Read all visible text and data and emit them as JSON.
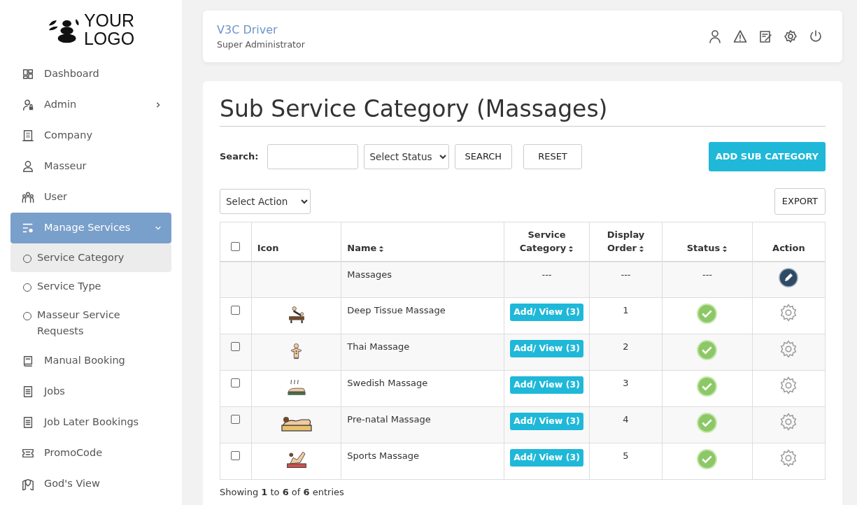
{
  "logo": {
    "line_1": "YOUR",
    "line_2": "LOGO"
  },
  "sidebar": {
    "items": [
      {
        "label": "Dashboard",
        "selected": false
      },
      {
        "label": "Admin",
        "selected": false,
        "expanded": false
      },
      {
        "label": "Company",
        "selected": false
      },
      {
        "label": "Masseur",
        "selected": false
      },
      {
        "label": "User",
        "selected": false
      },
      {
        "label": "Manage Services",
        "selected": true,
        "expanded": true,
        "children": [
          {
            "label": "Service Category",
            "selected": true
          },
          {
            "label": "Service Type",
            "selected": false
          },
          {
            "label": "Masseur Service Requests",
            "selected": false
          }
        ]
      },
      {
        "label": "Manual Booking",
        "selected": false
      },
      {
        "label": "Jobs",
        "selected": false
      },
      {
        "label": "Job Later Bookings",
        "selected": false
      },
      {
        "label": "PromoCode",
        "selected": false
      },
      {
        "label": "God's View",
        "selected": false
      }
    ]
  },
  "header": {
    "user_name": "V3C Driver",
    "role": "Super Administrator"
  },
  "page": {
    "title": "Sub Service Category (Massages)",
    "search_label": "Search:",
    "status_select": "Select Status",
    "search_button": "SEARCH",
    "reset_button": "RESET",
    "add_button": "ADD SUB CATEGORY",
    "action_select": "Select Action",
    "export_button": "EXPORT"
  },
  "table": {
    "select_all_checked": false,
    "columns": [
      {
        "label": "Icon",
        "sortable": false
      },
      {
        "label": "Name",
        "sortable": true
      },
      {
        "label": "Service Category",
        "sortable": true
      },
      {
        "label": "Display Order",
        "sortable": true
      },
      {
        "label": "Status",
        "sortable": true
      },
      {
        "label": "Action",
        "sortable": false
      }
    ],
    "rows": [
      {
        "kind": "parent",
        "name": "Massages",
        "service_category": "---",
        "display_order": "---",
        "status": "---"
      },
      {
        "kind": "child",
        "checked": false,
        "name": "Deep Tissue Massage",
        "service_category": "Add/ View (3)",
        "display_order": "1",
        "active": true
      },
      {
        "kind": "child",
        "checked": false,
        "name": "Thai Massage",
        "service_category": "Add/ View (3)",
        "display_order": "2",
        "active": true
      },
      {
        "kind": "child",
        "checked": false,
        "name": "Swedish Massage",
        "service_category": "Add/ View (3)",
        "display_order": "3",
        "active": true
      },
      {
        "kind": "child",
        "checked": false,
        "name": "Pre-natal Massage",
        "service_category": "Add/ View (3)",
        "display_order": "4",
        "active": true
      },
      {
        "kind": "child",
        "checked": false,
        "name": "Sports Massage",
        "service_category": "Add/ View (3)",
        "display_order": "5",
        "active": true
      }
    ]
  },
  "footer_info": "Showing **1** to **6** of **6** entries"
}
